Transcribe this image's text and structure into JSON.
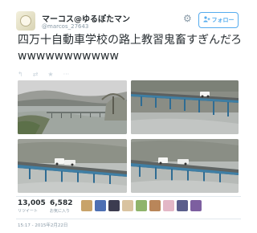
{
  "header": {
    "display_name": "マーコス@ゆるぽたマン",
    "username": "@marcos_27643",
    "follow_label": "フォロー"
  },
  "tweet": {
    "text": "四万十自動車学校の路上教習鬼畜すぎんだろwwwwwwwwwww"
  },
  "stats": {
    "retweets": "13,005",
    "retweets_label": "リツイート",
    "favorites": "6,582",
    "favorites_label": "お気に入り"
  },
  "timestamp": "15:17 - 2015年2月22日",
  "icons": {
    "settings": "gear-icon",
    "follow": "person-plus-icon",
    "reply": "reply-icon",
    "retweet": "retweet-icon",
    "favorite": "star-icon",
    "more": "more-icon"
  },
  "colors": {
    "accent": "#55acee",
    "text": "#292f33",
    "muted": "#8899a6",
    "divider": "#e1e8ed"
  }
}
